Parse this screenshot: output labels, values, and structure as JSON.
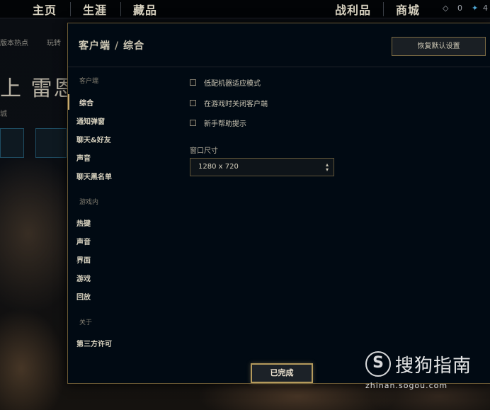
{
  "background": {
    "nav": {
      "home": "主页",
      "career": "生涯",
      "collection": "藏品",
      "loot": "战利品",
      "store": "商城",
      "blue_essence": "0",
      "rp": "4"
    },
    "subnav": [
      "版本热点",
      "玩转"
    ],
    "big_text": "上 雷恩",
    "small_text": "城"
  },
  "modal": {
    "breadcrumb": {
      "section": "客户端",
      "separator": "/",
      "page": "综合"
    },
    "restore_label": "恢复默认设置",
    "sidebar": {
      "client_title": "客户端",
      "client_items": [
        "综合",
        "通知弹窗",
        "聊天&好友",
        "声音",
        "聊天黑名单"
      ],
      "ingame_title": "游戏内",
      "ingame_items": [
        "热键",
        "声音",
        "界面",
        "游戏",
        "回放"
      ],
      "about_title": "关于",
      "about_items": [
        "第三方许可"
      ]
    },
    "options": [
      {
        "label": "低配机器适应模式",
        "checked": false
      },
      {
        "label": "在游戏时关闭客户端",
        "checked": false
      },
      {
        "label": "新手帮助提示",
        "checked": false
      }
    ],
    "window_size": {
      "label": "窗口尺寸",
      "value": "1280 x 720"
    },
    "done_label": "已完成"
  },
  "watermark": {
    "logo": "S",
    "text": "搜狗指南",
    "url": "zhinan.sogou.com"
  },
  "colors": {
    "accent_gold": "#c8aa6e",
    "modal_bg": "#010a13",
    "border_gold": "#6b5a35"
  }
}
